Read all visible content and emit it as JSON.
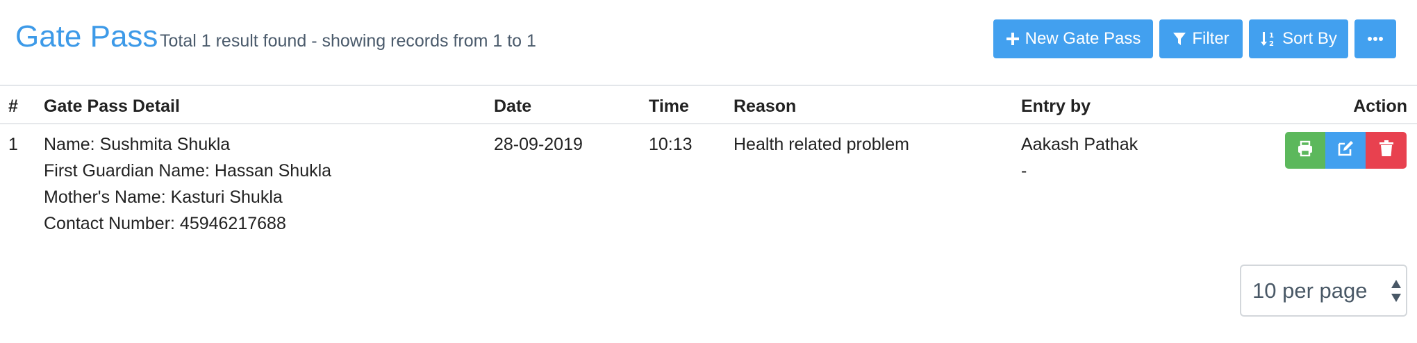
{
  "header": {
    "title": "Gate Pass",
    "subtitle": "Total 1 result found - showing records from 1 to 1",
    "buttons": {
      "new_label": "New Gate Pass",
      "filter_label": "Filter",
      "sort_label": "Sort By"
    }
  },
  "table": {
    "columns": [
      "#",
      "Gate Pass Detail",
      "Date",
      "Time",
      "Reason",
      "Entry by",
      "Action"
    ],
    "rows": [
      {
        "index": "1",
        "detail": [
          "Name: Sushmita Shukla",
          "First Guardian Name: Hassan Shukla",
          "Mother's Name: Kasturi Shukla",
          "Contact Number: 45946217688"
        ],
        "date": "28-09-2019",
        "time": "10:13",
        "reason": "Health related problem",
        "entry_by": [
          "Aakash Pathak",
          "-"
        ]
      }
    ]
  },
  "pagination": {
    "per_page": "10 per page"
  },
  "colors": {
    "primary": "#42a0ef",
    "title": "#3d9ae8",
    "success": "#5cb85c",
    "danger": "#e8414f"
  },
  "icons": {
    "new": "plus-icon",
    "filter": "filter-icon",
    "sort": "sort-numeric-icon",
    "more": "ellipsis-icon",
    "print": "print-icon",
    "edit": "edit-icon",
    "delete": "trash-icon",
    "select": "select-arrows-icon"
  }
}
